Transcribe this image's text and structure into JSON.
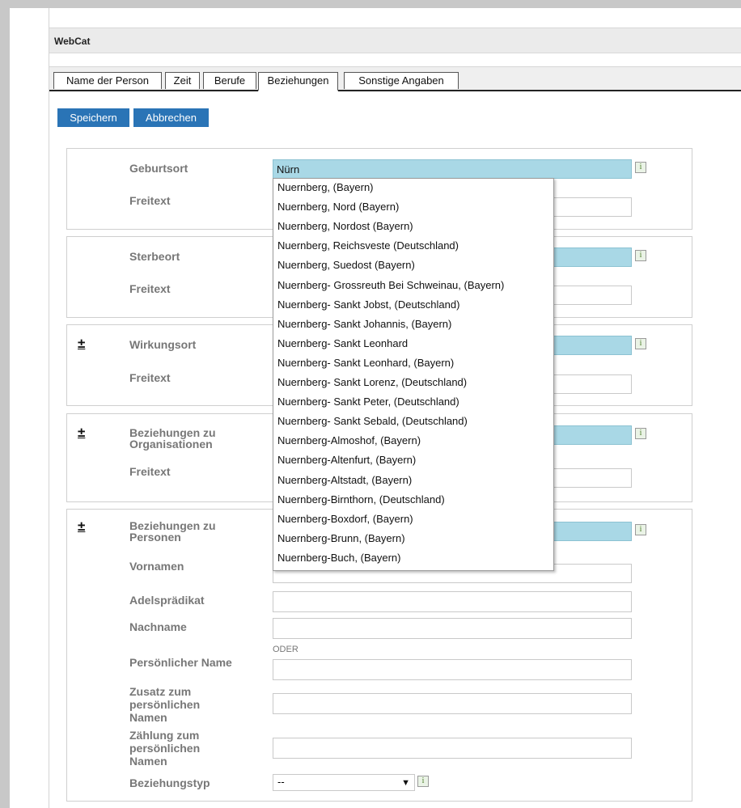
{
  "app": {
    "title": "WebCat"
  },
  "tabs": [
    "Name der Person",
    "Zeit",
    "Berufe",
    "Beziehungen",
    "Sonstige Angaben"
  ],
  "toolbar": {
    "save_label": "Speichern",
    "cancel_label": "Abbrechen"
  },
  "sections": {
    "geburtsort": {
      "label": "Geburtsort",
      "value": "Nürn",
      "freitext_label": "Freitext"
    },
    "sterbeort": {
      "label": "Sterbeort",
      "freitext_label": "Freitext"
    },
    "wirkungsort": {
      "label": "Wirkungsort",
      "freitext_label": "Freitext"
    },
    "organisationen": {
      "label_line1": "Beziehungen zu",
      "label_line2": "Organisationen",
      "freitext_label": "Freitext"
    },
    "personen": {
      "label_line1": "Beziehungen zu",
      "label_line2": "Personen",
      "vornamen_label": "Vornamen",
      "adel_label": "Adelsprädikat",
      "nachname_label": "Nachname",
      "oder_label": "ODER",
      "persname_label": "Persönlicher Name",
      "zusatz_label_1": "Zusatz zum",
      "zusatz_label_2": "persönlichen",
      "zusatz_label_3": "Namen",
      "zaehlung_label_1": "Zählung zum",
      "zaehlung_label_2": "persönlichen",
      "zaehlung_label_3": "Namen",
      "typ_label": "Beziehungstyp",
      "typ_value": "--"
    }
  },
  "icons": {
    "info": "i",
    "expand": "±"
  },
  "autocomplete": [
    "Nuernberg, (Bayern)",
    "Nuernberg, Nord (Bayern)",
    "Nuernberg, Nordost (Bayern)",
    "Nuernberg, Reichsveste (Deutschland)",
    "Nuernberg, Suedost (Bayern)",
    "Nuernberg- Grossreuth Bei Schweinau, (Bayern)",
    "Nuernberg- Sankt Jobst, (Deutschland)",
    "Nuernberg- Sankt Johannis, (Bayern)",
    "Nuernberg- Sankt Leonhard",
    "Nuernberg- Sankt Leonhard, (Bayern)",
    "Nuernberg- Sankt Lorenz, (Deutschland)",
    "Nuernberg- Sankt Peter, (Deutschland)",
    "Nuernberg- Sankt Sebald, (Deutschland)",
    "Nuernberg-Almoshof, (Bayern)",
    "Nuernberg-Altenfurt, (Bayern)",
    "Nuernberg-Altstadt, (Bayern)",
    "Nuernberg-Birnthorn, (Deutschland)",
    "Nuernberg-Boxdorf, (Bayern)",
    "Nuernberg-Brunn, (Bayern)",
    "Nuernberg-Buch, (Bayern)"
  ],
  "colors": {
    "accent": "#2a74b6",
    "highlight": "#a9d8e6"
  }
}
